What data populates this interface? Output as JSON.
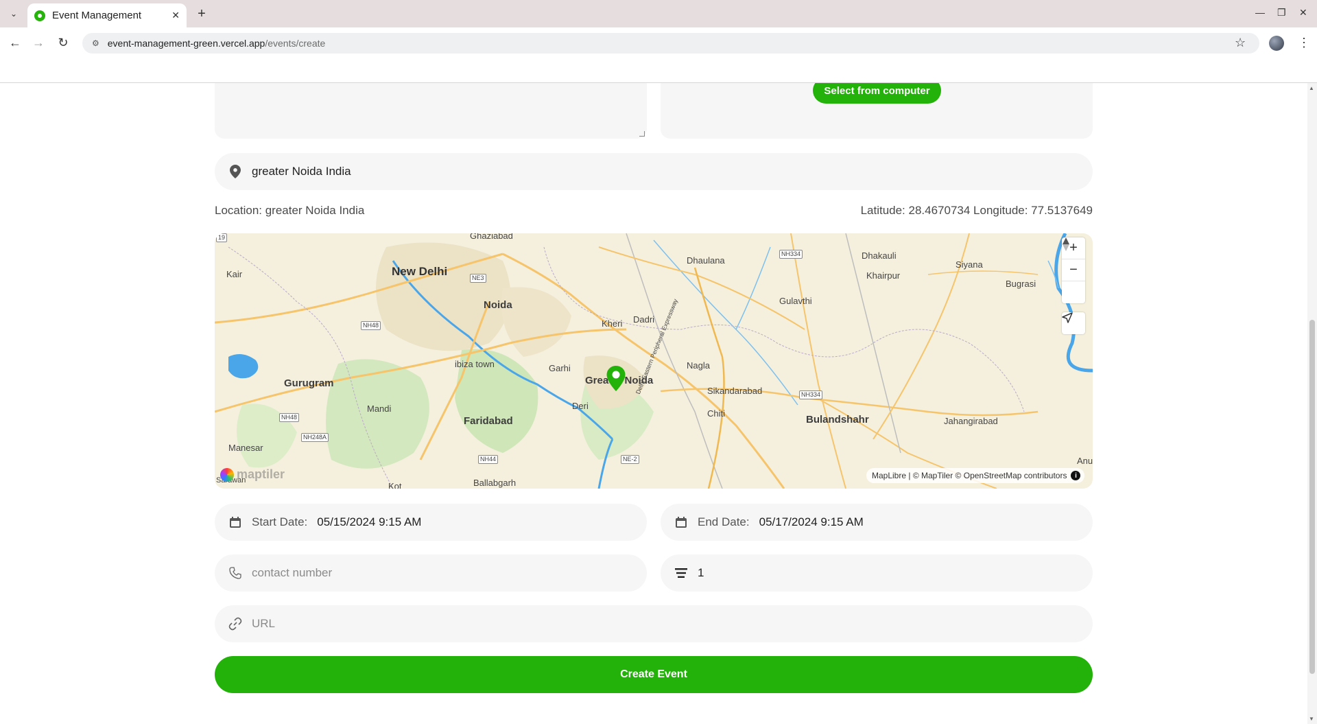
{
  "browser": {
    "tab_title": "Event Management",
    "url_host": "event-management-green.vercel.app",
    "url_path": "/events/create"
  },
  "form": {
    "upload_button": "Select from computer",
    "location_input": "greater Noida India",
    "location_label": "Location: greater Noida India",
    "coords_label": "Latitude: 28.4670734 Longitude: 77.5137649",
    "start_label": "Start Date:",
    "start_value": "05/15/2024 9:15 AM",
    "end_label": "End Date:",
    "end_value": "05/17/2024 9:15 AM",
    "contact_placeholder": "contact number",
    "capacity_value": "1",
    "url_placeholder": "URL",
    "submit_label": "Create Event"
  },
  "map": {
    "attribution": "MapLibre | © MapTiler © OpenStreetMap contributors",
    "brand": "maptiler",
    "labels": {
      "ghaziabad": "Ghaziabad",
      "new_delhi": "New Delhi",
      "noida": "Noida",
      "dhaulana": "Dhaulana",
      "dhakauli": "Dhakauli",
      "khairpur": "Khairpur",
      "siyana": "Siyana",
      "bugrasi": "Bugrasi",
      "gulavthi": "Gulavthi",
      "kair": "Kair",
      "kheri": "Kheri",
      "dadri": "Dadri",
      "nagla": "Nagla",
      "ibiza_town": "ibiza town",
      "garhi": "Garhi",
      "greater_noida": "Greater Noida",
      "gurugram": "Gurugram",
      "sikandarabad": "Sikandarabad",
      "mandi": "Mandi",
      "deri": "Deri",
      "faridabad": "Faridabad",
      "chiti": "Chiti",
      "bulandshahr": "Bulandshahr",
      "jahangirabad": "Jahangirabad",
      "manesar": "Manesar",
      "ballabgarh": "Ballabgarh",
      "kot": "Kot",
      "anu": "Anu",
      "sarawan": "Sarawan",
      "expressway": "Delhi Eastern Peripheral Expressway"
    },
    "shields": {
      "nh3": "NE3",
      "nh334a": "NH334",
      "nh48a": "NH48",
      "nh48b": "NH48",
      "nh248a": "NH248A",
      "nh44": "NH44",
      "ne2": "NE-2",
      "nh334b": "NH334",
      "r9": "19"
    },
    "colors": {
      "land": "#f5f0dd",
      "water": "#4aa6e8",
      "road": "#f5c46b",
      "forest": "#cfe6b8",
      "marker": "#22b20a"
    }
  },
  "icons": {
    "pin": "map-pin-icon",
    "calendar": "calendar-icon",
    "phone": "phone-icon",
    "list": "list-icon",
    "link": "link-icon"
  }
}
